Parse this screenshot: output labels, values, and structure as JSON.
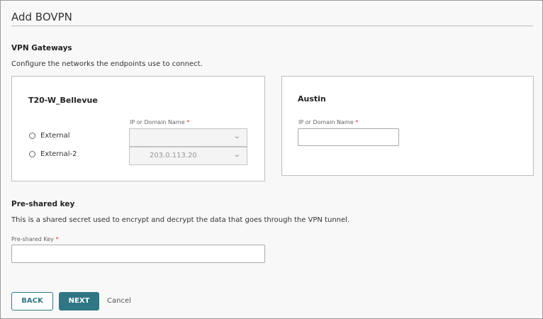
{
  "title": "Add BOVPN",
  "gateways": {
    "heading": "VPN Gateways",
    "description": "Configure the networks the endpoints use to connect.",
    "local": {
      "name": "T20-W_Bellevue",
      "field_label": "IP or Domain Name",
      "required": "*",
      "options": [
        {
          "label": "External",
          "value": ""
        },
        {
          "label": "External-2",
          "value": "203.0.113.20"
        }
      ]
    },
    "remote": {
      "name": "Austin",
      "field_label": "IP or Domain Name",
      "required": "*",
      "value": ""
    }
  },
  "psk": {
    "heading": "Pre-shared key",
    "description": "This is a shared secret used to encrypt and decrypt the data that goes through the VPN tunnel.",
    "field_label": "Pre-shared Key",
    "required": "*",
    "value": ""
  },
  "buttons": {
    "back": "BACK",
    "next": "NEXT",
    "cancel": "Cancel"
  },
  "colors": {
    "accent": "#2f7784"
  }
}
